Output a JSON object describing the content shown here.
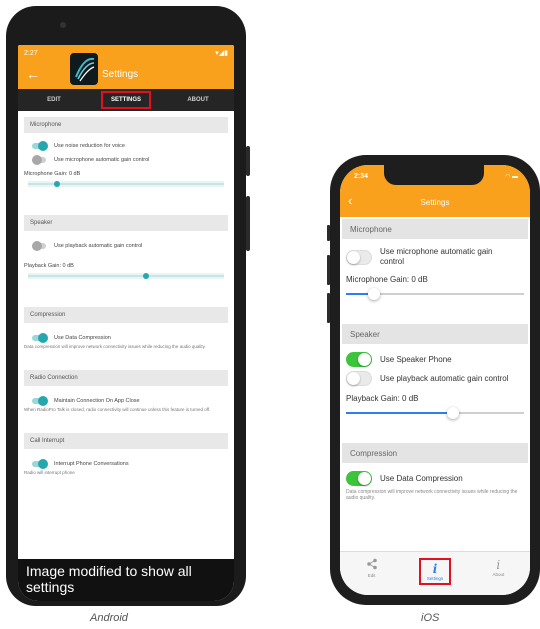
{
  "android": {
    "status_time": "2:27",
    "status_icons": "▾◢▮",
    "title": "Settings",
    "tabs": [
      {
        "label": "EDIT"
      },
      {
        "label": "SETTINGS"
      },
      {
        "label": "ABOUT"
      }
    ],
    "microphone": {
      "header": "Microphone",
      "noise_reduction": "Use noise reduction for voice",
      "auto_gain": "Use microphone automatic gain control",
      "gain_label": "Microphone Gain: 0 dB",
      "gain_fraction": 0.15
    },
    "speaker": {
      "header": "Speaker",
      "auto_gain": "Use playback automatic gain control",
      "gain_label": "Playback Gain: 0 dB",
      "gain_fraction": 0.6
    },
    "compression": {
      "header": "Compression",
      "toggle": "Use Data Compression",
      "desc": "Data compression will improve network connectivity issues while reducing the audio quality."
    },
    "radio_connection": {
      "header": "Radio Connection",
      "toggle": "Maintain Connection On App Close",
      "desc": "When RadioPro Talk is closed, radio connectivity will continue unless this feature is turned off."
    },
    "call_interrupt": {
      "header": "Call Interrupt",
      "toggle": "Interrupt Phone Conversations",
      "desc": "Radio will interrupt phone"
    },
    "overlay_text": "Image modified to show all settings",
    "caption": "Android"
  },
  "ios": {
    "status_time": "2:34",
    "status_icons": "◠ ▬",
    "title": "Settings",
    "microphone": {
      "header": "Microphone",
      "auto_gain": "Use microphone automatic gain control",
      "gain_label": "Microphone Gain: 0 dB",
      "gain_fraction": 0.16
    },
    "speaker": {
      "header": "Speaker",
      "speaker_phone": "Use Speaker Phone",
      "auto_gain": "Use playback automatic gain control",
      "gain_label": "Playback Gain: 0 dB",
      "gain_fraction": 0.6
    },
    "compression": {
      "header": "Compression",
      "toggle": "Use Data Compression",
      "desc": "Data compression will improve network connectivity issues while reducing the audio quality."
    },
    "tabbar": [
      {
        "label": "Edit",
        "icon": "share-icon"
      },
      {
        "label": "Settings",
        "icon": "info-icon"
      },
      {
        "label": "About",
        "icon": "info-icon"
      }
    ],
    "caption": "iOS"
  },
  "colors": {
    "accent_orange": "#f9a11d",
    "android_teal": "#26a7ad",
    "ios_green": "#3cc43c",
    "ios_blue": "#2f7ef0",
    "highlight_red": "#e0121f"
  }
}
